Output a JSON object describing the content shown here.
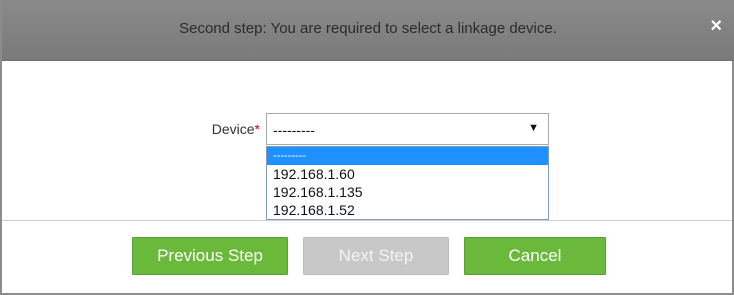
{
  "dialog": {
    "title": "Second step: You are required to select a linkage device.",
    "close_symbol": "×"
  },
  "form": {
    "device_label": "Device",
    "required_marker": "*",
    "device_select": {
      "value": "---------",
      "arrow_symbol": "▼",
      "options": [
        "---------",
        "192.168.1.60",
        "192.168.1.135",
        "192.168.1.52"
      ],
      "highlighted_index": 0
    }
  },
  "buttons": {
    "previous": "Previous Step",
    "next": "Next Step",
    "cancel": "Cancel"
  },
  "colors": {
    "button_green": "#6bb93b",
    "button_disabled": "#c8c8c8",
    "highlight_blue": "#1e90ff",
    "titlebar": "#808080",
    "required": "#d0021b"
  },
  "icons": {
    "close": "close-icon",
    "dropdown": "chevron-down-icon"
  }
}
